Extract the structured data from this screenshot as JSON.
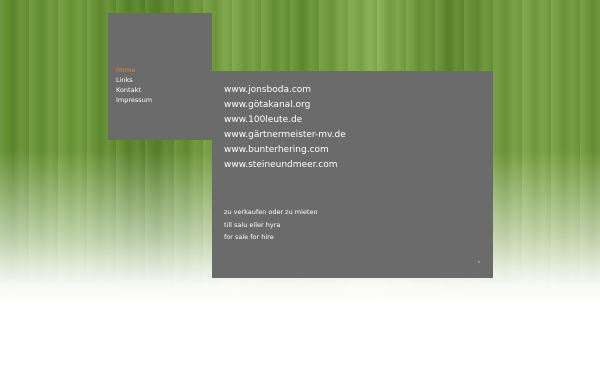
{
  "nav": {
    "items": [
      {
        "label": "Home"
      },
      {
        "label": "Links"
      },
      {
        "label": "Kontakt"
      },
      {
        "label": "Impressum"
      }
    ],
    "active_color": "#e8872a"
  },
  "links": [
    "www.jonsboda.com",
    "www.götakanal.org",
    "www.100leute.de",
    "www.gärtnermeister-mv.de",
    "www.bunterhering.com",
    "www.steineundmeer.com"
  ],
  "taglines": [
    "zu verkaufen oder zu mieten",
    "till salu eller hyra",
    "for sale for hire"
  ],
  "corner_mark": "°",
  "colors": {
    "panel": "#6b6b6b",
    "text": "#ffffff",
    "background": "#6e9a38"
  }
}
